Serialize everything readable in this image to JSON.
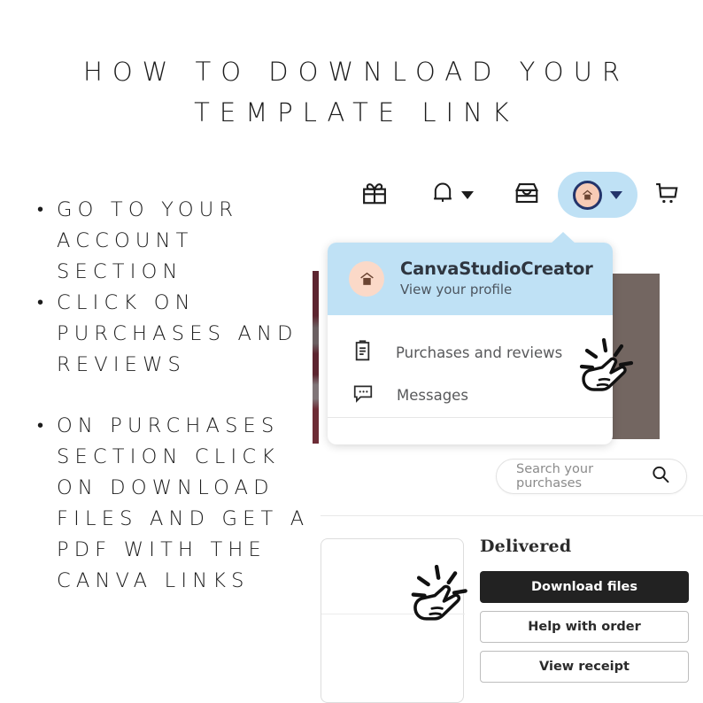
{
  "title": {
    "line1": "HOW TO DOWNLOAD YOUR",
    "line2": "TEMPLATE LINK"
  },
  "instructions": [
    "GO TO YOUR ACCOUNT SECTION",
    "CLICK ON PURCHASES AND REVIEWS",
    "ON PURCHASES SECTION CLICK ON DOWNLOAD FILES AND GET A PDF WITH THE CANVA LINKS"
  ],
  "nav": {
    "items": [
      {
        "icon": "gift-icon",
        "label": "Gifts"
      },
      {
        "icon": "bell-icon",
        "label": "Notifications"
      },
      {
        "icon": "shop-icon",
        "label": "Your shop"
      },
      {
        "icon": "account-avatar-icon",
        "label": "You"
      },
      {
        "icon": "cart-icon",
        "label": "Cart"
      }
    ]
  },
  "account_dropdown": {
    "username": "CanvaStudioCreator",
    "subtitle": "View your profile",
    "avatar_icon": "shop-avatar-icon",
    "menu": [
      {
        "icon": "clipboard-icon",
        "label": "Purchases and reviews"
      },
      {
        "icon": "message-bubble-icon",
        "label": "Messages"
      }
    ]
  },
  "search": {
    "placeholder": "Search your purchases",
    "icon": "search-icon"
  },
  "order": {
    "status": "Delivered",
    "buttons": [
      {
        "label": "Download files",
        "style": "primary"
      },
      {
        "label": "Help with order",
        "style": "secondary"
      },
      {
        "label": "View receipt",
        "style": "secondary"
      }
    ]
  },
  "cursors": [
    {
      "name": "click-cursor-purchases",
      "icon": "pointing-hand-click-icon"
    },
    {
      "name": "click-cursor-download",
      "icon": "pointing-hand-click-icon"
    }
  ],
  "colors": {
    "background": "#ffffff",
    "accent_blue": "#bfe1f5",
    "text_dark": "#1c1c1c",
    "button_dark": "#222222",
    "backdrop_brown": "#736661",
    "backdrop_maroon": "#5d2530"
  }
}
